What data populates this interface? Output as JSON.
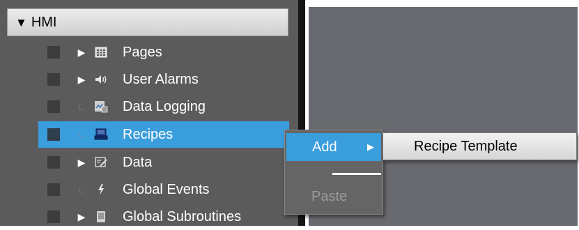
{
  "tree": {
    "root": {
      "label": "HMI",
      "expander_icon": "triangle-down"
    },
    "items": [
      {
        "label": "Pages",
        "expander": "▶",
        "icon": "pages-icon",
        "selected": false
      },
      {
        "label": "User Alarms",
        "expander": "▶",
        "icon": "speaker-icon",
        "selected": false
      },
      {
        "label": "Data Logging",
        "expander": "∟",
        "icon": "data-logging-icon",
        "selected": false
      },
      {
        "label": "Recipes",
        "expander": "∟",
        "icon": "recipes-icon",
        "selected": true
      },
      {
        "label": "Data",
        "expander": "▶",
        "icon": "data-icon",
        "selected": false
      },
      {
        "label": "Global Events",
        "expander": "∟",
        "icon": "lightning-icon",
        "selected": false
      },
      {
        "label": "Global Subroutines",
        "expander": "▶",
        "icon": "subroutine-icon",
        "selected": false
      }
    ]
  },
  "context_menu": {
    "add_label": "Add",
    "add_arrow": "▶",
    "paste_label": "Paste"
  },
  "submenu": {
    "items": [
      {
        "label": "Recipe Template"
      }
    ]
  },
  "colors": {
    "selection": "#3a9ddc",
    "panel_bg": "#5b5b5b",
    "editor_bg": "#696a6f",
    "splitter": "#151515"
  }
}
